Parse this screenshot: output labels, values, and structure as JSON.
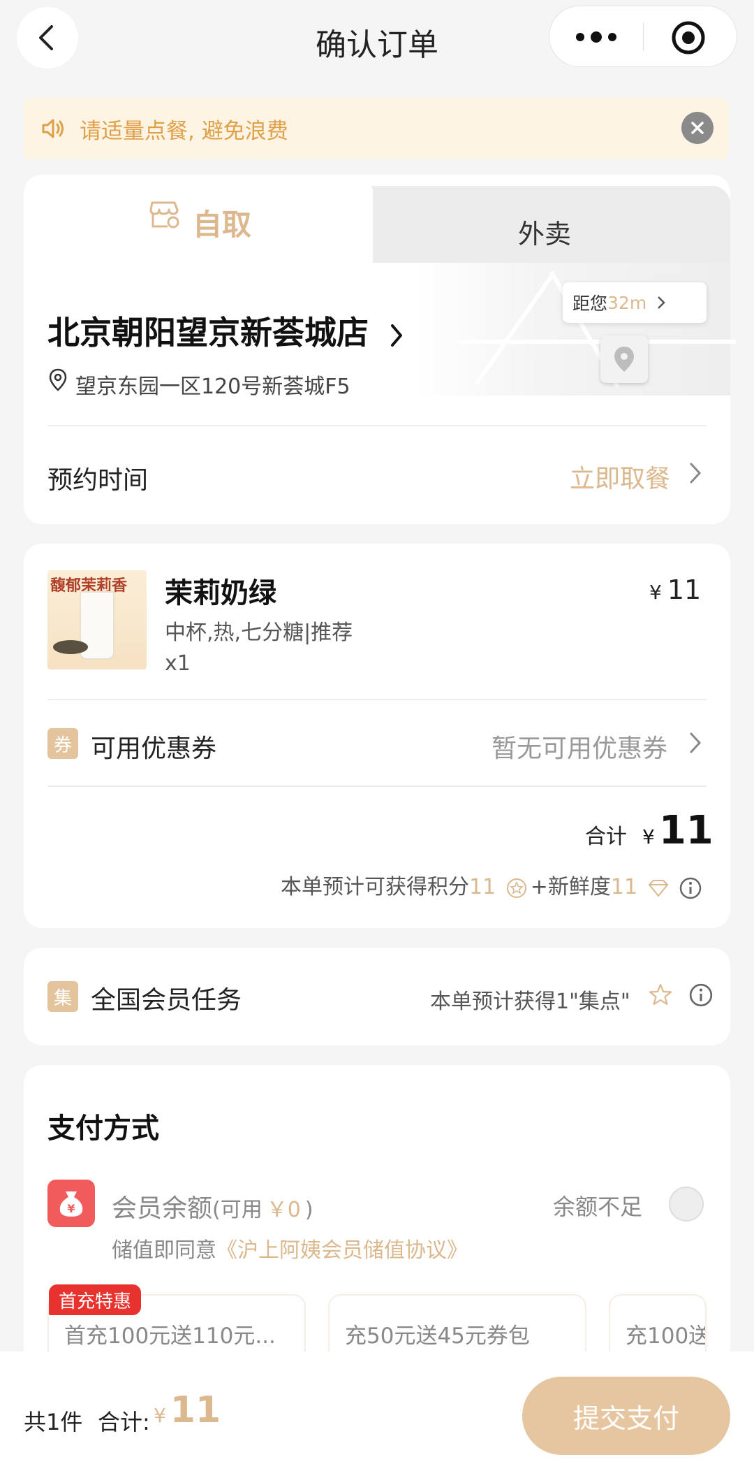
{
  "header": {
    "title": "确认订单",
    "back_icon": "chevron-left-icon",
    "more_icon": "more-dots-icon",
    "target_icon": "record-icon"
  },
  "notice": {
    "text": "请适量点餐, 避免浪费",
    "icon": "speaker-icon",
    "close_icon": "close-icon"
  },
  "tabs": {
    "pickup_label": "自取",
    "delivery_label": "外卖",
    "active": "pickup"
  },
  "store": {
    "name": "北京朝阳望京新荟城店",
    "address": "望京东园一区120号新荟城F5",
    "distance_prefix": "距您",
    "distance_value": "32m"
  },
  "schedule": {
    "label": "预约时间",
    "value": "立即取餐"
  },
  "product": {
    "name": "茉莉奶绿",
    "spec": "中杯,热,七分糖|推荐",
    "qty": "x1",
    "price_symbol": "¥",
    "price": "11",
    "image_banner": "馥郁茉莉香"
  },
  "coupon": {
    "tag": "券",
    "label": "可用优惠券",
    "value": "暂无可用优惠券"
  },
  "summary": {
    "total_label": "合计",
    "currency": "¥",
    "total": "11",
    "points_prefix": "本单预计可获得积分",
    "points_value": "11",
    "freshness_prefix": "+新鲜度",
    "freshness_value": "11"
  },
  "member_task": {
    "tag": "集",
    "label": "全国会员任务",
    "value": "本单预计获得1\"集点\""
  },
  "payment": {
    "title": "支付方式",
    "balance_label": "会员余额",
    "balance_available_open": "(可用",
    "balance_available_value": "￥0",
    "balance_available_close": ")",
    "balance_status": "余额不足",
    "agree_prefix": "储值即同意",
    "agree_link": "《沪上阿姨会员储值协议》",
    "recharge_options": [
      {
        "label": "首充100元送110元..."
      },
      {
        "label": "充50元送45元券包"
      },
      {
        "label": "充100送"
      }
    ],
    "first_badge": "首充特惠"
  },
  "bottom": {
    "count": "共1件",
    "total_label": "合计:",
    "currency": "¥",
    "total": "11",
    "submit": "提交支付"
  },
  "colors": {
    "accent_gold": "#dbb88e",
    "submit_bg": "#e6c6a0",
    "notice_bg": "#fdf4e4",
    "notice_text": "#e0a04a",
    "badge_red": "#e8322e",
    "wallet_red": "#f25b5b"
  }
}
